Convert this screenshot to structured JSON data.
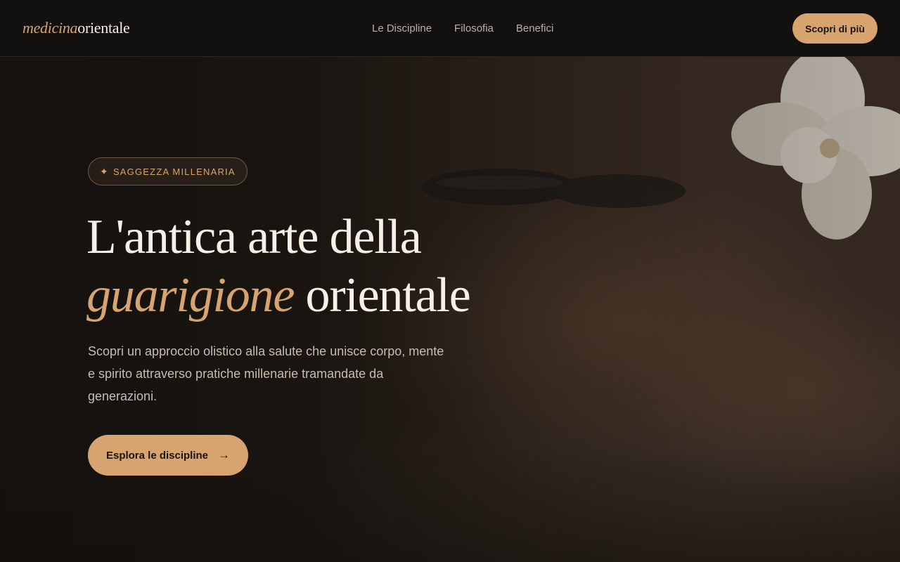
{
  "header": {
    "logo": {
      "italic": "medicina",
      "plain": "orientale"
    },
    "nav": [
      {
        "label": "Le Discipline"
      },
      {
        "label": "Filosofia"
      },
      {
        "label": "Benefici"
      }
    ],
    "cta_label": "Scopri di più"
  },
  "hero": {
    "badge": {
      "icon": "sparkle-icon",
      "label": "SAGGEZZA MILLENARIA"
    },
    "title": {
      "line1": "L'antica arte della",
      "accent": "guarigione",
      "line2_rest": " orientale"
    },
    "description": "Scopri un approccio olistico alla salute che unisce corpo, mente e spirito attraverso pratiche millenarie tramandate da generazioni.",
    "cta": {
      "label": "Esplora le discipline",
      "icon": "arrow-right-icon"
    }
  },
  "colors": {
    "accent": "#d7a470",
    "background": "#13110f",
    "text": "#f3ede4"
  }
}
